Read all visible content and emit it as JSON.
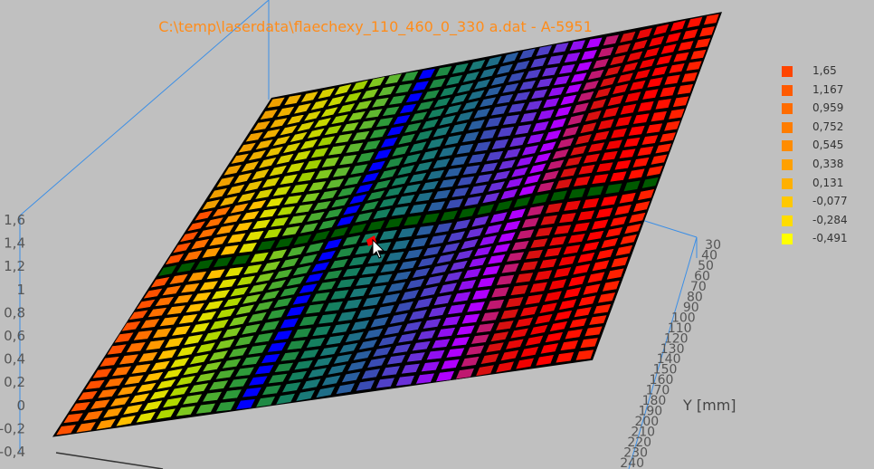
{
  "window": {
    "title": "C:\\temp\\laserdata\\flaechexy_110_460_0_330 a.dat - A-5951"
  },
  "chart_data": {
    "type": "surface3d",
    "title": "C:\\temp\\laserdata\\flaechexy_110_460_0_330 a.dat - A-5951",
    "z_axis": {
      "ticks": [
        "1,6",
        "1,4",
        "1,2",
        "1",
        "0,8",
        "0,6",
        "0,4",
        "0,2",
        "0",
        "-0,2",
        "-0,4"
      ],
      "range": [
        -0.4,
        1.6
      ]
    },
    "y_axis": {
      "label": "Y [mm]",
      "ticks": [
        "30",
        "40",
        "50",
        "60",
        "70",
        "80",
        "90",
        "100",
        "110",
        "120",
        "130",
        "140",
        "150",
        "160",
        "170",
        "180",
        "190",
        "200",
        "210",
        "220",
        "230",
        "240"
      ],
      "range": [
        30,
        240
      ]
    },
    "legend": {
      "placement": "right",
      "entries": [
        {
          "label": "1,65",
          "color": "#ff4500"
        },
        {
          "label": "1,167",
          "color": "#ff5a00"
        },
        {
          "label": "0,959",
          "color": "#ff6c00"
        },
        {
          "label": "0,752",
          "color": "#ff7d00"
        },
        {
          "label": "0,545",
          "color": "#ff8c00"
        },
        {
          "label": "0,338",
          "color": "#ffa000"
        },
        {
          "label": "0,131",
          "color": "#ffb000"
        },
        {
          "label": "-0,077",
          "color": "#ffc800"
        },
        {
          "label": "-0,284",
          "color": "#ffdc00"
        },
        {
          "label": "-0,491",
          "color": "#ffff00"
        }
      ]
    },
    "grid": true,
    "surface_color_bands": [
      "#ff5000",
      "#ff7000",
      "#ff9900",
      "#ffc000",
      "#e0e000",
      "#b0d800",
      "#7ec820",
      "#4cad30",
      "#2e9a3a",
      "#0000ff",
      "#1f8a44",
      "#158060",
      "#1a7a78",
      "#1e6e88",
      "#2a5ea0",
      "#3a4cb4",
      "#5040c8",
      "#6a30d8",
      "#9010f0",
      "#b000ff",
      "#c01870",
      "#d81010",
      "#e80808",
      "#f00000",
      "#ff0000",
      "#ff1000",
      "#ff2000"
    ],
    "dark_green_row": "#005a00"
  }
}
